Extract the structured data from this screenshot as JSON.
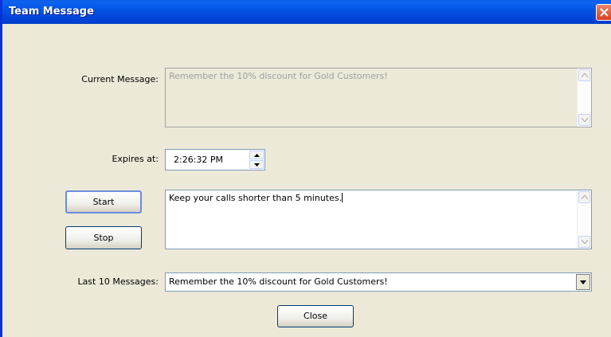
{
  "window": {
    "title": "Team Message"
  },
  "current_message": {
    "label": "Current Message:",
    "value": "Remember the 10% discount for Gold Customers!"
  },
  "expires": {
    "label": "Expires at:",
    "value": "2:26:32 PM"
  },
  "buttons": {
    "start": "Start",
    "stop": "Stop",
    "close": "Close"
  },
  "new_message": {
    "value": "Keep your calls shorter than 5 minutes."
  },
  "last_messages": {
    "label": "Last 10 Messages:",
    "selected": "Remember the 10% discount for Gold Customers!"
  },
  "colors": {
    "titlebar": "#0353e4",
    "window_bg": "#ece9d8",
    "close_button": "#d8411f",
    "input_border": "#7f9db9"
  }
}
